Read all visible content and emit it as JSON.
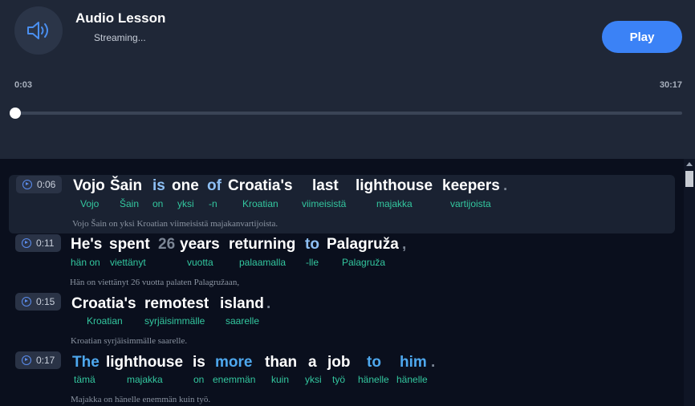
{
  "player": {
    "title": "Audio Lesson",
    "status": "Streaming...",
    "play_label": "Play",
    "current_time": "0:03",
    "total_time": "30:17",
    "progress_fraction": 0.0017
  },
  "segments": [
    {
      "timestamp": "0:06",
      "words": [
        "Vojo",
        "Šain",
        "is",
        "one",
        "of",
        "Croatia's",
        "last",
        "lighthouse",
        "keepers",
        "."
      ],
      "glosses": [
        "Vojo",
        "Šain",
        "on",
        "yksi",
        "-n",
        "Kroatian",
        "viimeisistä",
        "majakka",
        "vartijoista"
      ],
      "translation": "Vojo Šain on yksi Kroatian viimeisistä majakanvartijoista."
    },
    {
      "timestamp": "0:11",
      "words": [
        "He's",
        "spent",
        "26",
        "years",
        "returning",
        "to",
        "Palagruža",
        ","
      ],
      "glosses": [
        "hän on",
        "viettänyt",
        "vuotta",
        "palaamalla",
        "-lle",
        "Palagruža"
      ],
      "translation": "Hän on viettänyt 26 vuotta palaten Palagružaan,"
    },
    {
      "timestamp": "0:15",
      "words": [
        "Croatia's",
        "remotest",
        "island",
        "."
      ],
      "glosses": [
        "Kroatian",
        "syrjäisimmälle",
        "saarelle"
      ],
      "translation": "Kroatian syrjäisimmälle saarelle."
    },
    {
      "timestamp": "0:17",
      "words": [
        "The",
        "lighthouse",
        "is",
        "more",
        "than",
        "a",
        "job",
        "to",
        "him",
        "."
      ],
      "glosses": [
        "tämä",
        "majakka",
        "on",
        "enemmän",
        "kuin",
        "yksi",
        "työ",
        "hänelle",
        "hänelle"
      ],
      "translation": "Majakka on hänelle enemmän kuin työ."
    }
  ]
}
